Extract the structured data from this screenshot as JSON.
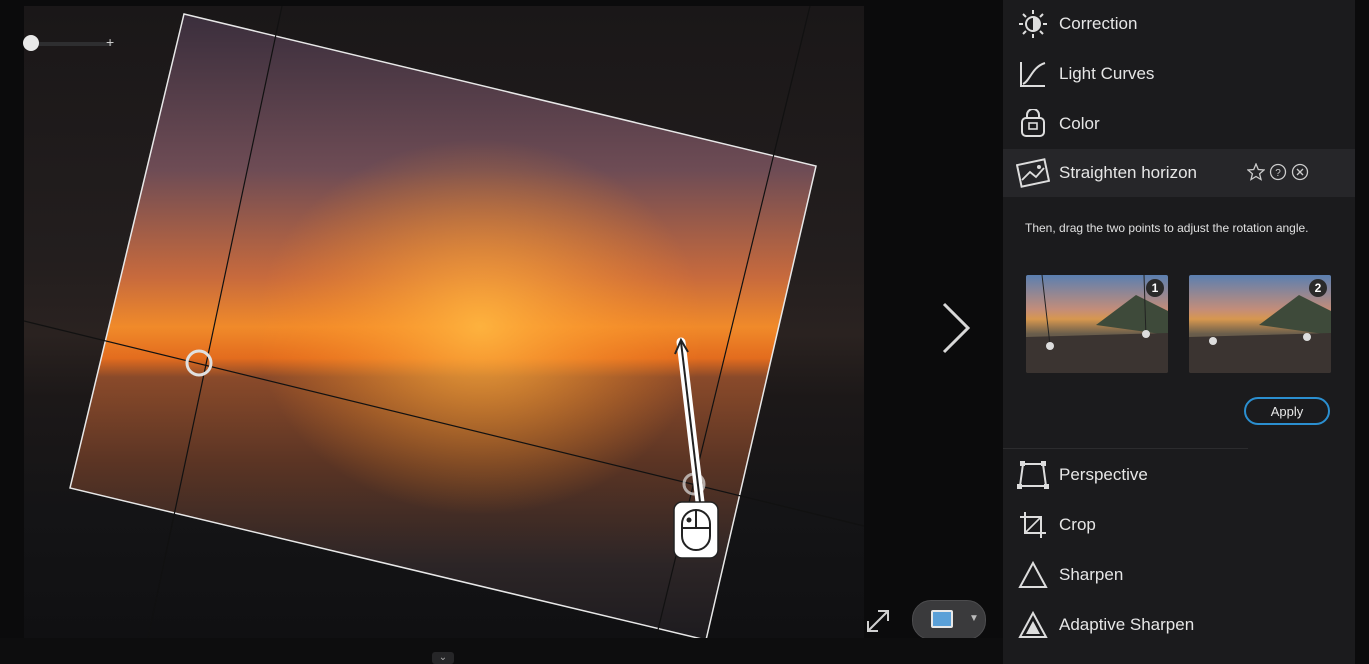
{
  "tools_top": [
    {
      "label": "Correction",
      "icon": "sun-icon"
    },
    {
      "label": "Light Curves",
      "icon": "curves-icon"
    },
    {
      "label": "Color",
      "icon": "color-icon"
    }
  ],
  "active_tool": {
    "label": "Straighten horizon",
    "icon": "straighten-horizon-icon",
    "help_text": "Then, drag the two points to adjust the rotation angle.",
    "thumbnails": [
      {
        "number": "1"
      },
      {
        "number": "2"
      }
    ],
    "apply_label": "Apply"
  },
  "tools_bottom": [
    {
      "label": "Perspective",
      "icon": "perspective-icon"
    },
    {
      "label": "Crop",
      "icon": "crop-icon"
    },
    {
      "label": "Sharpen",
      "icon": "sharpen-icon"
    },
    {
      "label": "Adaptive Sharpen",
      "icon": "adaptive-sharpen-icon"
    }
  ],
  "zoom": {
    "plus": "+"
  },
  "colors": {
    "accent": "#2b8fd0",
    "panel": "#1b1b1d"
  }
}
